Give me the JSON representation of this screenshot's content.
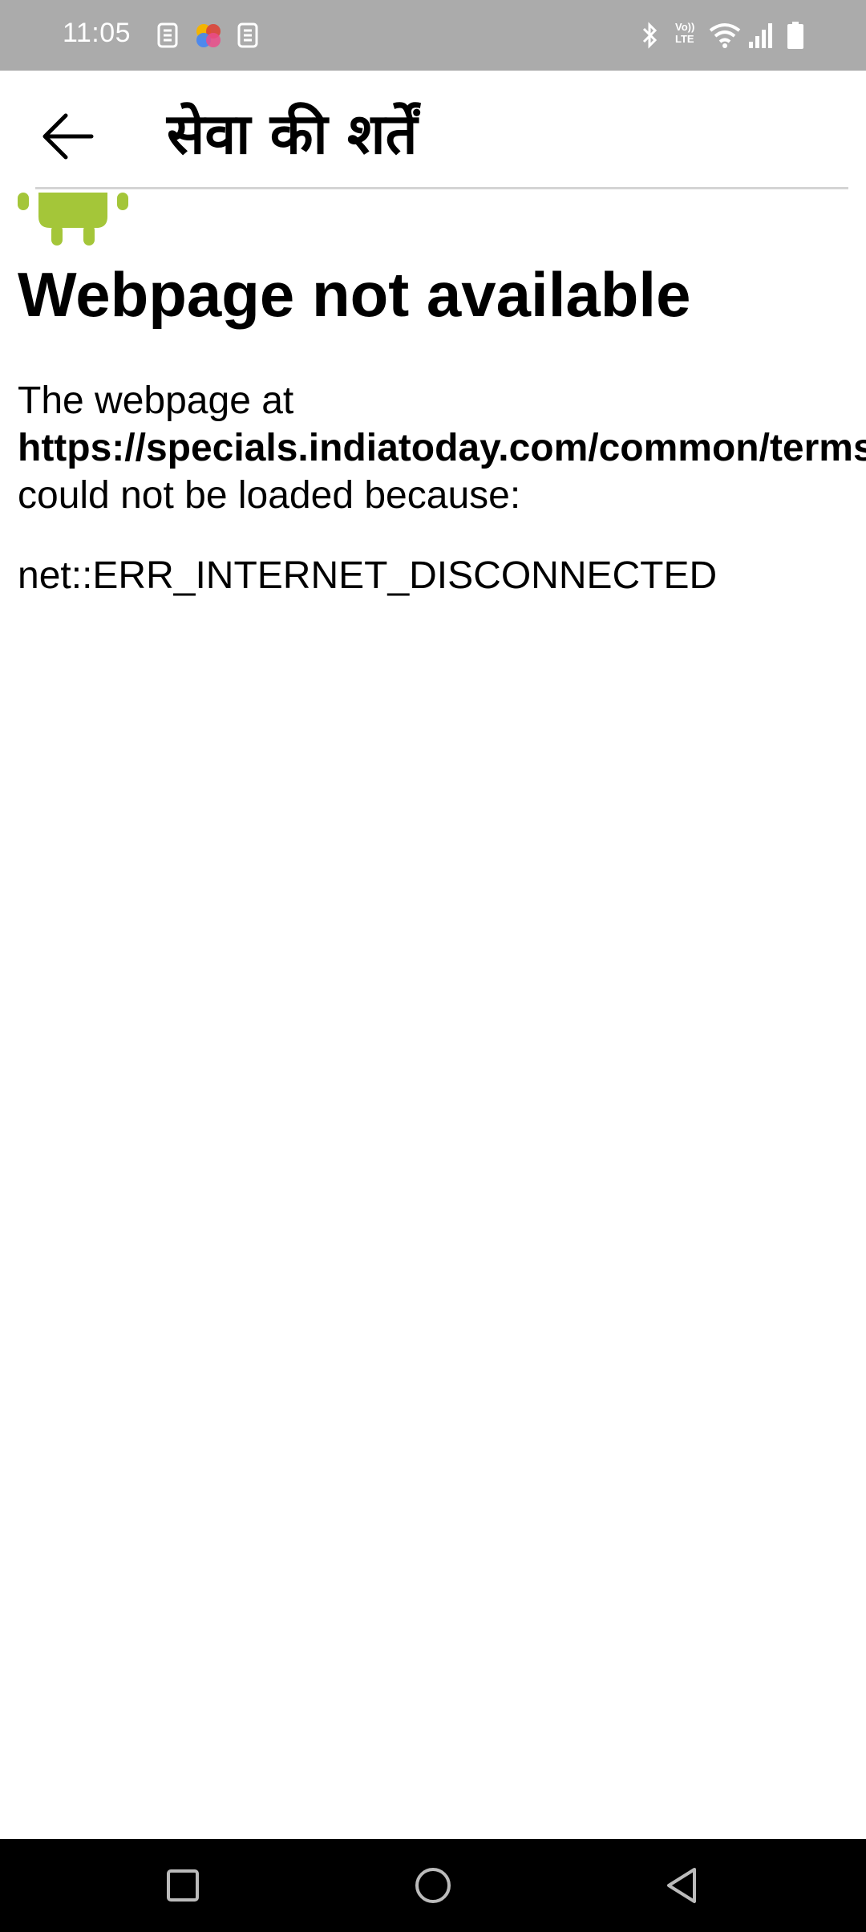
{
  "status_bar": {
    "time": "11:05",
    "left_icons": [
      "sim-toolkit-icon",
      "photos-app-icon",
      "sim-toolkit-icon"
    ],
    "right_icons": [
      "bluetooth-icon",
      "volte-icon",
      "wifi-icon",
      "signal-icon",
      "battery-icon"
    ],
    "volte_label_top": "Vo))",
    "volte_label_bottom": "LTE"
  },
  "app_bar": {
    "title": "सेवा की शर्तें",
    "back_icon": "arrow-back-icon"
  },
  "error_page": {
    "icon": "android-robot-icon",
    "title": "Webpage not available",
    "line1": "The webpage at",
    "url": "https://specials.indiatoday.com/common/terms",
    "line3": "could not be loaded because:",
    "error_code": "net::ERR_INTERNET_DISCONNECTED"
  },
  "nav_bar": {
    "buttons": [
      "recents-icon",
      "home-icon",
      "back-icon"
    ]
  },
  "colors": {
    "status_bar": "#ababab",
    "android_green": "#a4c639",
    "nav_bar": "#000000"
  }
}
